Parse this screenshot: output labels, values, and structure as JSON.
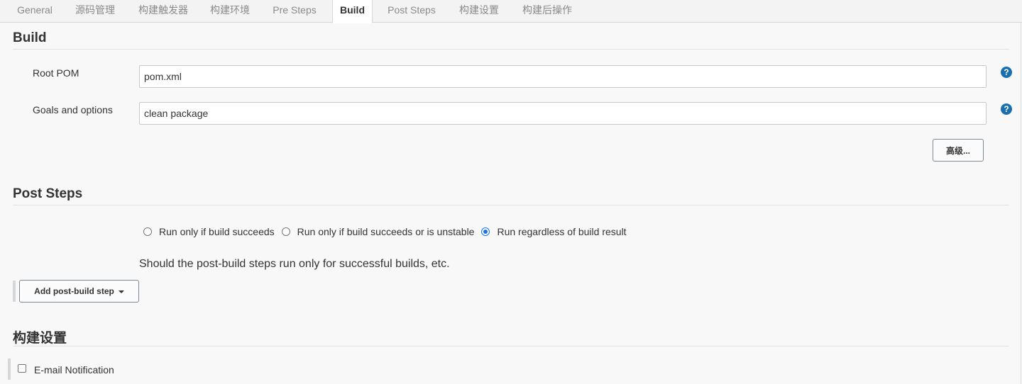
{
  "tabs": [
    {
      "label": "General"
    },
    {
      "label": "源码管理"
    },
    {
      "label": "构建触发器"
    },
    {
      "label": "构建环境"
    },
    {
      "label": "Pre Steps"
    },
    {
      "label": "Build",
      "active": true
    },
    {
      "label": "Post Steps"
    },
    {
      "label": "构建设置"
    },
    {
      "label": "构建后操作"
    }
  ],
  "build": {
    "title": "Build",
    "root_pom_label": "Root POM",
    "root_pom_value": "pom.xml",
    "goals_label": "Goals and options",
    "goals_value": "clean package",
    "help_glyph": "?",
    "advanced_button": "高级..."
  },
  "post_steps": {
    "title": "Post Steps",
    "options": [
      {
        "label": "Run only if build succeeds",
        "checked": false
      },
      {
        "label": "Run only if build succeeds or is unstable",
        "checked": false
      },
      {
        "label": "Run regardless of build result",
        "checked": true
      }
    ],
    "description": "Should the post-build steps run only for successful builds, etc.",
    "add_button": "Add post-build step"
  },
  "build_settings": {
    "title": "构建设置",
    "email_label": "E-mail Notification",
    "email_checked": false
  },
  "colors": {
    "accent": "#1a73e8",
    "help": "#1a6fae",
    "background": "#f8f8f8"
  }
}
